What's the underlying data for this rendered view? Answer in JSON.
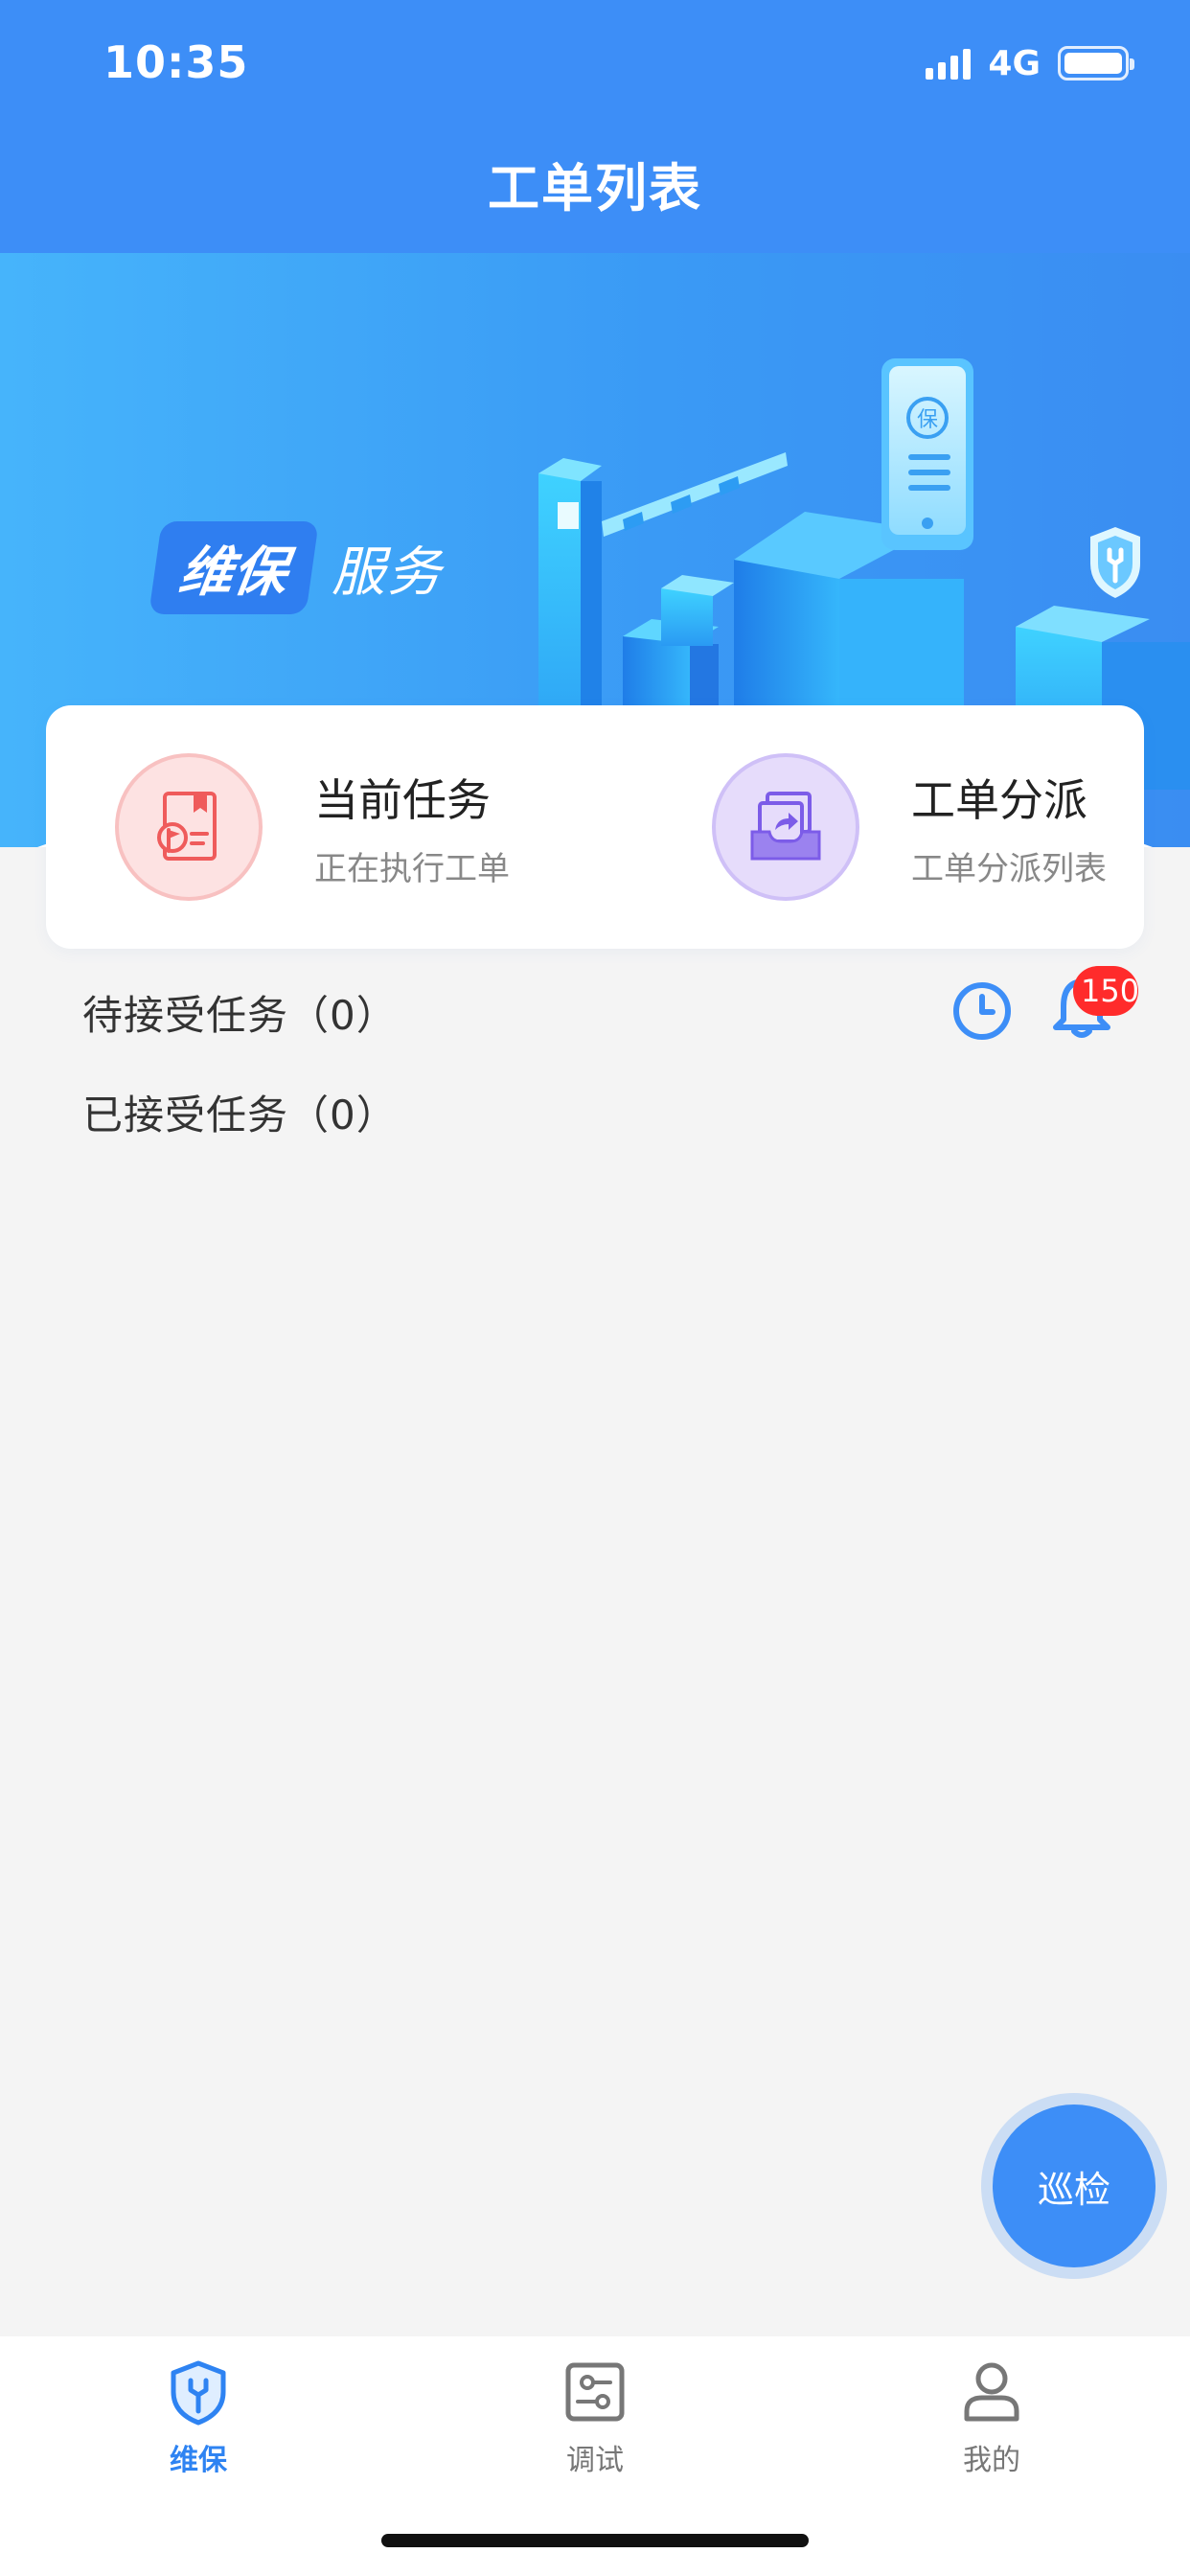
{
  "status_bar": {
    "time": "10:35",
    "network": "4G"
  },
  "header": {
    "title": "工单列表"
  },
  "banner": {
    "tag_highlight": "维保",
    "tag_text": "服务",
    "art_seal": "保"
  },
  "quick_actions": [
    {
      "title": "当前任务",
      "subtitle": "正在执行工单",
      "icon": "task-flag-icon",
      "color": "#f06a6a"
    },
    {
      "title": "工单分派",
      "subtitle": "工单分派列表",
      "icon": "dispatch-share-icon",
      "color": "#7c5ce8"
    }
  ],
  "tasks": {
    "pending_label": "待接受任务（0）",
    "accepted_label": "已接受任务（0）"
  },
  "notifications": {
    "badge_count": "150"
  },
  "fab": {
    "label": "巡检"
  },
  "tabbar": {
    "items": [
      {
        "label": "维保",
        "icon": "shield-wrench-icon",
        "active": true
      },
      {
        "label": "调试",
        "icon": "sliders-icon",
        "active": false
      },
      {
        "label": "我的",
        "icon": "person-icon",
        "active": false
      }
    ]
  },
  "colors": {
    "primary": "#3d8ef7",
    "badge": "#ff2b2b",
    "background": "#f4f4f4"
  }
}
